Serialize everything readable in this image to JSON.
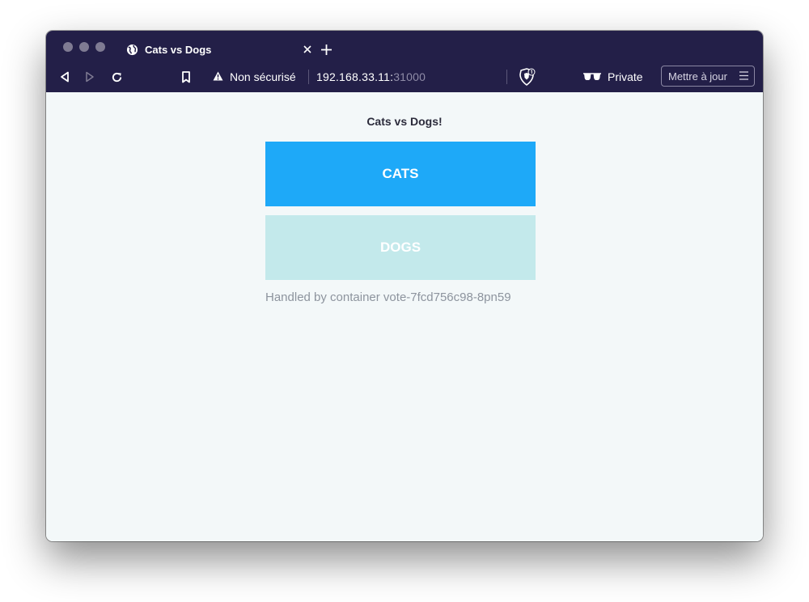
{
  "browser": {
    "tab": {
      "title": "Cats vs Dogs",
      "icon": "globe-icon"
    },
    "toolbar": {
      "security_label": "Non sécurisé",
      "url_host": "192.168.33.11:",
      "url_port": "31000",
      "private_label": "Private",
      "update_button": "Mettre à jour"
    },
    "colors": {
      "chrome": "#231f48",
      "page_background": "#f3f8f9"
    }
  },
  "page": {
    "heading": "Cats vs Dogs!",
    "buttons": [
      {
        "label": "CATS",
        "color": "#1ea9f8",
        "state": "selected"
      },
      {
        "label": "DOGS",
        "color": "#c3e9eb",
        "state": "faded"
      }
    ],
    "footer": "Handled by container vote-7fcd756c98-8pn59"
  }
}
